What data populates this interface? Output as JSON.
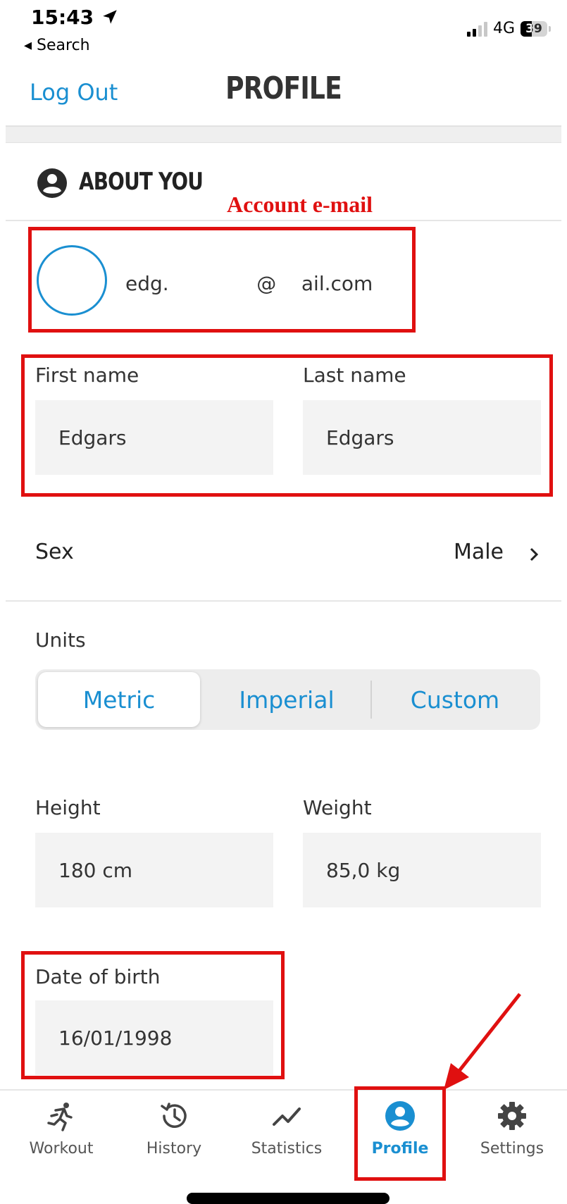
{
  "status_bar": {
    "time": "15:43",
    "back_label": "◂ Search",
    "network": "4G",
    "battery": "39"
  },
  "header": {
    "logout_label": "Log Out",
    "title": "PROFILE"
  },
  "about": {
    "section_title": "ABOUT YOU",
    "annotation": "Account e-mail",
    "email": "edg.              @    ail.com"
  },
  "name": {
    "first_label": "First name",
    "first_value": "Edgars",
    "last_label": "Last name",
    "last_value": "Edgars"
  },
  "sex": {
    "label": "Sex",
    "value": "Male"
  },
  "units": {
    "label": "Units",
    "options": [
      "Metric",
      "Imperial",
      "Custom"
    ],
    "selected": "Metric"
  },
  "measurements": {
    "height_label": "Height",
    "height_value": "180 cm",
    "weight_label": "Weight",
    "weight_value": "85,0 kg"
  },
  "birth": {
    "label": "Date of birth",
    "value": "16/01/1998"
  },
  "tabbar": {
    "items": [
      {
        "label": "Workout",
        "icon": "running-icon"
      },
      {
        "label": "History",
        "icon": "history-icon"
      },
      {
        "label": "Statistics",
        "icon": "statistics-icon"
      },
      {
        "label": "Profile",
        "icon": "profile-icon"
      },
      {
        "label": "Settings",
        "icon": "gear-icon"
      }
    ],
    "active": "Profile"
  },
  "colors": {
    "accent": "#1a8fd1",
    "annotation": "#e01010"
  }
}
